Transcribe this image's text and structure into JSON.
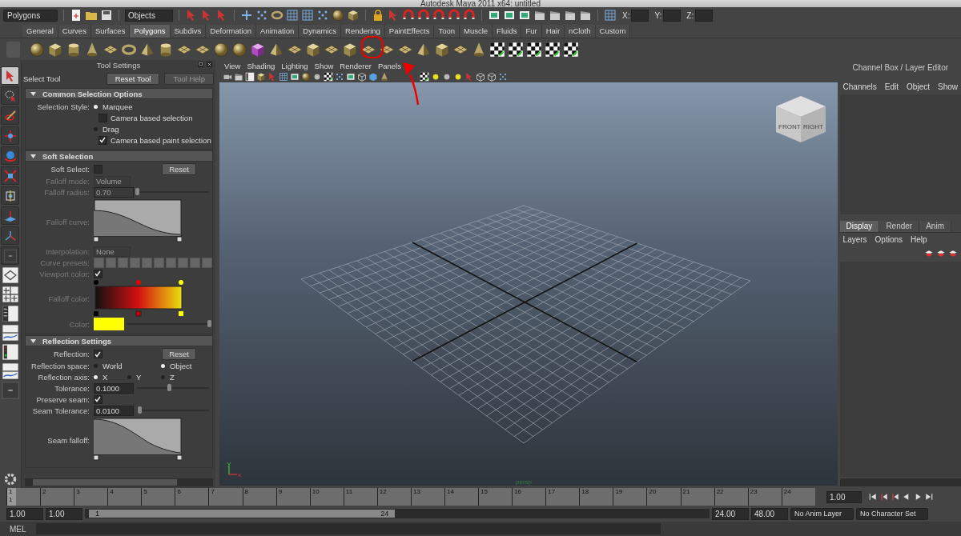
{
  "window": {
    "title": "Autodesk Maya 2011 x64: untitled"
  },
  "status_line": {
    "menu_set": "Polygons",
    "selection_mode": "Objects",
    "coords": [
      "X:",
      "Y:",
      "Z:"
    ]
  },
  "shelf_tabs": [
    {
      "label": "General",
      "selected": false
    },
    {
      "label": "Curves",
      "selected": false
    },
    {
      "label": "Surfaces",
      "selected": false
    },
    {
      "label": "Polygons",
      "selected": true
    },
    {
      "label": "Subdivs",
      "selected": false
    },
    {
      "label": "Deformation",
      "selected": false
    },
    {
      "label": "Animation",
      "selected": false
    },
    {
      "label": "Dynamics",
      "selected": false
    },
    {
      "label": "Rendering",
      "selected": false
    },
    {
      "label": "PaintEffects",
      "selected": false
    },
    {
      "label": "Toon",
      "selected": false
    },
    {
      "label": "Muscle",
      "selected": false
    },
    {
      "label": "Fluids",
      "selected": false
    },
    {
      "label": "Fur",
      "selected": false
    },
    {
      "label": "Hair",
      "selected": false
    },
    {
      "label": "nCloth",
      "selected": false
    },
    {
      "label": "Custom",
      "selected": false
    }
  ],
  "toolbox": [
    {
      "selected": true
    },
    {
      "selected": false
    },
    {
      "selected": false
    },
    {
      "selected": false
    },
    {
      "selected": false
    },
    {
      "selected": false
    },
    {
      "selected": false
    },
    {
      "selected": false
    },
    {
      "selected": false
    },
    {
      "selected": false
    }
  ],
  "tool_settings": {
    "title": "Tool Settings",
    "tool_name": "Select Tool",
    "buttons": [
      {
        "label": "Reset Tool",
        "disabled": false
      },
      {
        "label": "Tool Help",
        "disabled": true
      }
    ],
    "sections": [
      {
        "title": "Common Selection Options",
        "expanded": true,
        "rows": [
          {
            "kind": "radio",
            "label": "Selection Style:",
            "disabled": false,
            "options": [
              {
                "label": "Marquee",
                "selected": true
              }
            ]
          },
          {
            "kind": "checkbox",
            "text": "Camera based selection",
            "checked": false,
            "disabled": false
          },
          {
            "kind": "radio",
            "disabled": false,
            "options": [
              {
                "label": "Drag",
                "selected": false
              }
            ]
          },
          {
            "kind": "checkbox",
            "text": "Camera based paint selection",
            "checked": true,
            "disabled": false
          }
        ]
      },
      {
        "title": "Soft Selection",
        "expanded": true,
        "rows": [
          {
            "kind": "checkbox",
            "label": "Soft Select:",
            "checked": false,
            "disabled": false,
            "button": "Reset"
          },
          {
            "kind": "dropdown",
            "label": "Falloff mode:",
            "value": "Volume",
            "disabled": true
          },
          {
            "kind": "slider",
            "label": "Falloff radius:",
            "value": "0.70",
            "level": 0,
            "disabled": true
          },
          {
            "kind": "falloff-curve",
            "label": "Falloff curve:",
            "disabled": true
          },
          {
            "kind": "dropdown",
            "label": "Interpolation:",
            "value": "None",
            "disabled": true
          },
          {
            "kind": "presets",
            "label": "Curve presets:",
            "disabled": true
          },
          {
            "kind": "checkbox",
            "label": "Viewport color:",
            "checked": true,
            "disabled": true
          },
          {
            "kind": "gradient",
            "label": "Falloff color:",
            "disabled": true
          },
          {
            "kind": "color",
            "label": "Color:",
            "color": "#ffff00",
            "level": 1,
            "disabled": true
          }
        ]
      },
      {
        "title": "Reflection Settings",
        "expanded": true,
        "rows": [
          {
            "kind": "checkbox",
            "label": "Reflection:",
            "checked": true,
            "disabled": false,
            "button": "Reset"
          },
          {
            "kind": "radio",
            "label": "Reflection space:",
            "disabled": false,
            "options": [
              {
                "label": "World",
                "selected": false
              },
              {
                "label": "Object",
                "selected": true
              }
            ]
          },
          {
            "kind": "radio",
            "label": "Reflection axis:",
            "disabled": false,
            "options": [
              {
                "label": "X",
                "selected": true
              },
              {
                "label": "Y",
                "selected": false
              },
              {
                "label": "Z",
                "selected": false
              }
            ]
          },
          {
            "kind": "slider",
            "label": "Tolerance:",
            "value": "0.1000",
            "level": 0.45,
            "disabled": false
          },
          {
            "kind": "checkbox",
            "label": "Preserve seam:",
            "checked": true,
            "disabled": false
          },
          {
            "kind": "slider",
            "label": "Seam Tolerance:",
            "value": "0.0100",
            "level": 0.03,
            "disabled": false
          },
          {
            "kind": "seam-curve",
            "label": "Seam falloff:",
            "disabled": false
          }
        ]
      }
    ]
  },
  "viewport": {
    "menus": [
      "View",
      "Shading",
      "Lighting",
      "Show",
      "Renderer",
      "Panels"
    ],
    "view_cube": [
      "FRONT",
      "RIGHT"
    ],
    "axes": [
      "y",
      "x"
    ],
    "camera": "persp"
  },
  "channel_box": {
    "title": "Channel Box / Layer Editor",
    "menus": [
      "Channels",
      "Edit",
      "Object",
      "Show"
    ],
    "layer_tabs": [
      {
        "label": "Display",
        "selected": true
      },
      {
        "label": "Render",
        "selected": false
      },
      {
        "label": "Anim",
        "selected": false
      }
    ],
    "layer_menus": [
      "Layers",
      "Options",
      "Help"
    ]
  },
  "time_slider": {
    "frames": [
      "1",
      "2",
      "3",
      "4",
      "5",
      "6",
      "7",
      "8",
      "9",
      "10",
      "11",
      "12",
      "13",
      "14",
      "15",
      "16",
      "17",
      "18",
      "19",
      "20",
      "21",
      "22",
      "23",
      "24"
    ],
    "current_frame": "1",
    "level": 0,
    "current_time": "1.00"
  },
  "range_slider": {
    "level": 0.49,
    "start": "1.00",
    "playback_start": "1.00",
    "range_start": "1",
    "range_end": "24",
    "playback_end": "24.00",
    "end": "48.00",
    "anim_layer": "No Anim Layer",
    "character_set": "No Character Set"
  },
  "command_line": {
    "language": "MEL"
  }
}
